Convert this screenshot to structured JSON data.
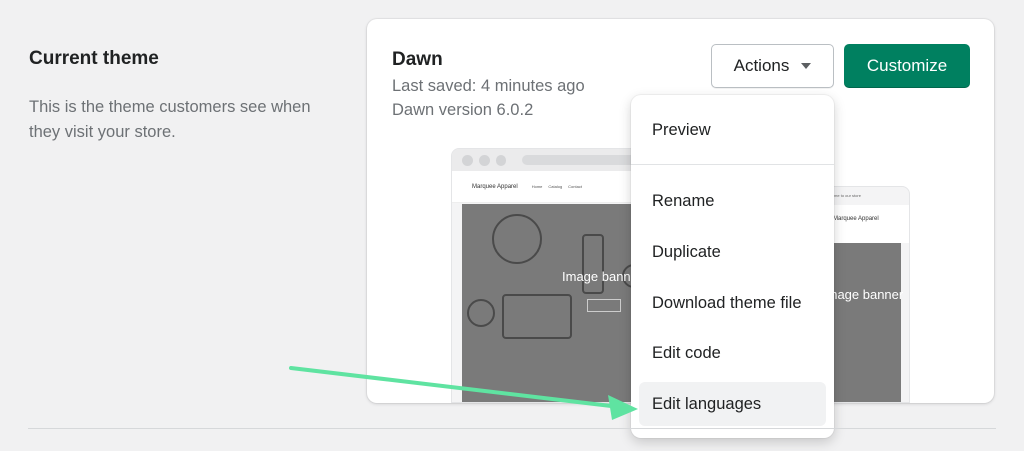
{
  "section": {
    "title": "Current theme",
    "description": "This is the theme customers see when they visit your store."
  },
  "theme": {
    "name": "Dawn",
    "last_saved": "Last saved: 4 minutes ago",
    "version": "Dawn version 6.0.2"
  },
  "buttons": {
    "actions_label": "Actions",
    "customize_label": "Customize",
    "primary_color": "#008060"
  },
  "preview": {
    "desktop": {
      "logo": "Marquee Apparel",
      "nav": [
        "Home",
        "Catalog",
        "Contact"
      ],
      "banner_title": "Image banner"
    },
    "mobile": {
      "topbar": "Welcome to our store",
      "logo": "Marquee Apparel",
      "banner_title": "Image banner"
    }
  },
  "actions_menu": {
    "items": [
      {
        "label": "Preview"
      },
      {
        "label": "Rename"
      },
      {
        "label": "Duplicate"
      },
      {
        "label": "Download theme file"
      },
      {
        "label": "Edit code"
      },
      {
        "label": "Edit languages",
        "highlighted": true
      }
    ]
  },
  "annotation": {
    "arrow_color": "#5fe3a1"
  }
}
